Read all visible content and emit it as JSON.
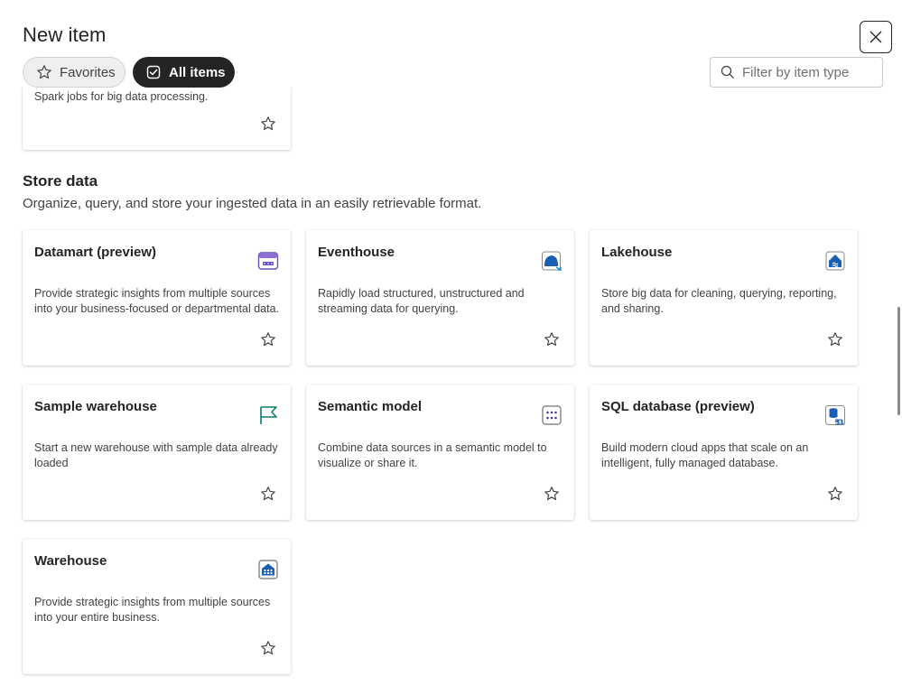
{
  "header": {
    "title": "New item",
    "close_label": "Close"
  },
  "filters": {
    "favorites_label": "Favorites",
    "all_items_label": "All items",
    "search_placeholder": "Filter by item type"
  },
  "partial_card": {
    "description": "Spark jobs for big data processing."
  },
  "section": {
    "title": "Store data",
    "subtitle": "Organize, query, and store your ingested data in an easily retrievable format."
  },
  "cards": [
    {
      "title": "Datamart (preview)",
      "description": "Provide strategic insights from multiple sources into your business-focused or departmental data.",
      "icon": "datamart-icon"
    },
    {
      "title": "Eventhouse",
      "description": "Rapidly load structured, unstructured and streaming data for querying.",
      "icon": "eventhouse-icon"
    },
    {
      "title": "Lakehouse",
      "description": "Store big data for cleaning, querying, reporting, and sharing.",
      "icon": "lakehouse-icon"
    },
    {
      "title": "Sample warehouse",
      "description": "Start a new warehouse with sample data already loaded",
      "icon": "flag-icon"
    },
    {
      "title": "Semantic model",
      "description": "Combine data sources in a semantic model to visualize or share it.",
      "icon": "semantic-model-icon"
    },
    {
      "title": "SQL database (preview)",
      "description": "Build modern cloud apps that scale on an intelligent, fully managed database.",
      "icon": "sql-database-icon"
    },
    {
      "title": "Warehouse",
      "description": "Provide strategic insights from multiple sources into your entire business.",
      "icon": "warehouse-icon"
    }
  ],
  "colors": {
    "accent_dark": "#242424",
    "icon_blue": "#1a5fb4",
    "icon_purple": "#6b4fbb",
    "icon_teal": "#0e7a6b"
  }
}
